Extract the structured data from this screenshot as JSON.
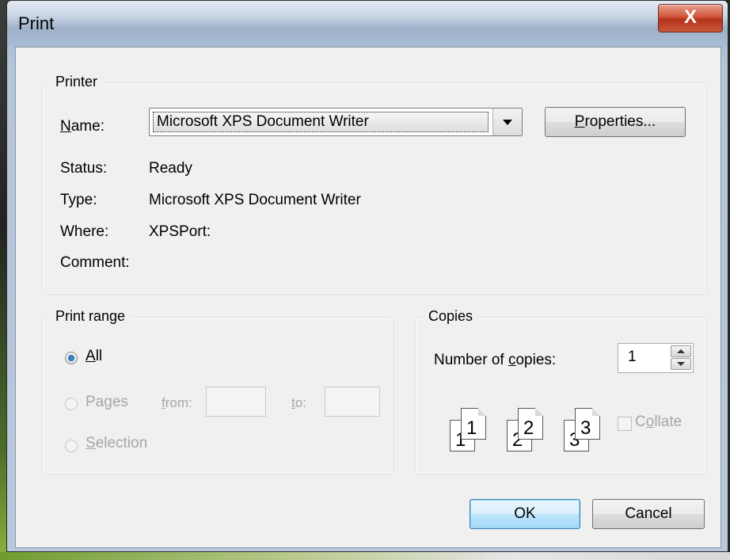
{
  "window": {
    "title": "Print",
    "close_glyph": "X"
  },
  "printer": {
    "legend": "Printer",
    "name_label": "Name:",
    "name_value": "Microsoft XPS Document Writer",
    "properties_label": "Properties...",
    "status_label": "Status:",
    "status_value": "Ready",
    "type_label": "Type:",
    "type_value": "Microsoft XPS Document Writer",
    "where_label": "Where:",
    "where_value": "XPSPort:",
    "comment_label": "Comment:",
    "comment_value": ""
  },
  "print_range": {
    "legend": "Print range",
    "all_label": "All",
    "pages_label": "Pages",
    "from_label": "from:",
    "from_value": "",
    "to_label": "to:",
    "to_value": "",
    "selection_label": "Selection",
    "selected": "All"
  },
  "copies": {
    "legend": "Copies",
    "number_label": "Number of copies:",
    "number_value": "1",
    "collate_label": "Collate",
    "collate_checked": false,
    "pages": [
      "1",
      "1",
      "2",
      "2",
      "3",
      "3"
    ]
  },
  "buttons": {
    "ok": "OK",
    "cancel": "Cancel"
  }
}
